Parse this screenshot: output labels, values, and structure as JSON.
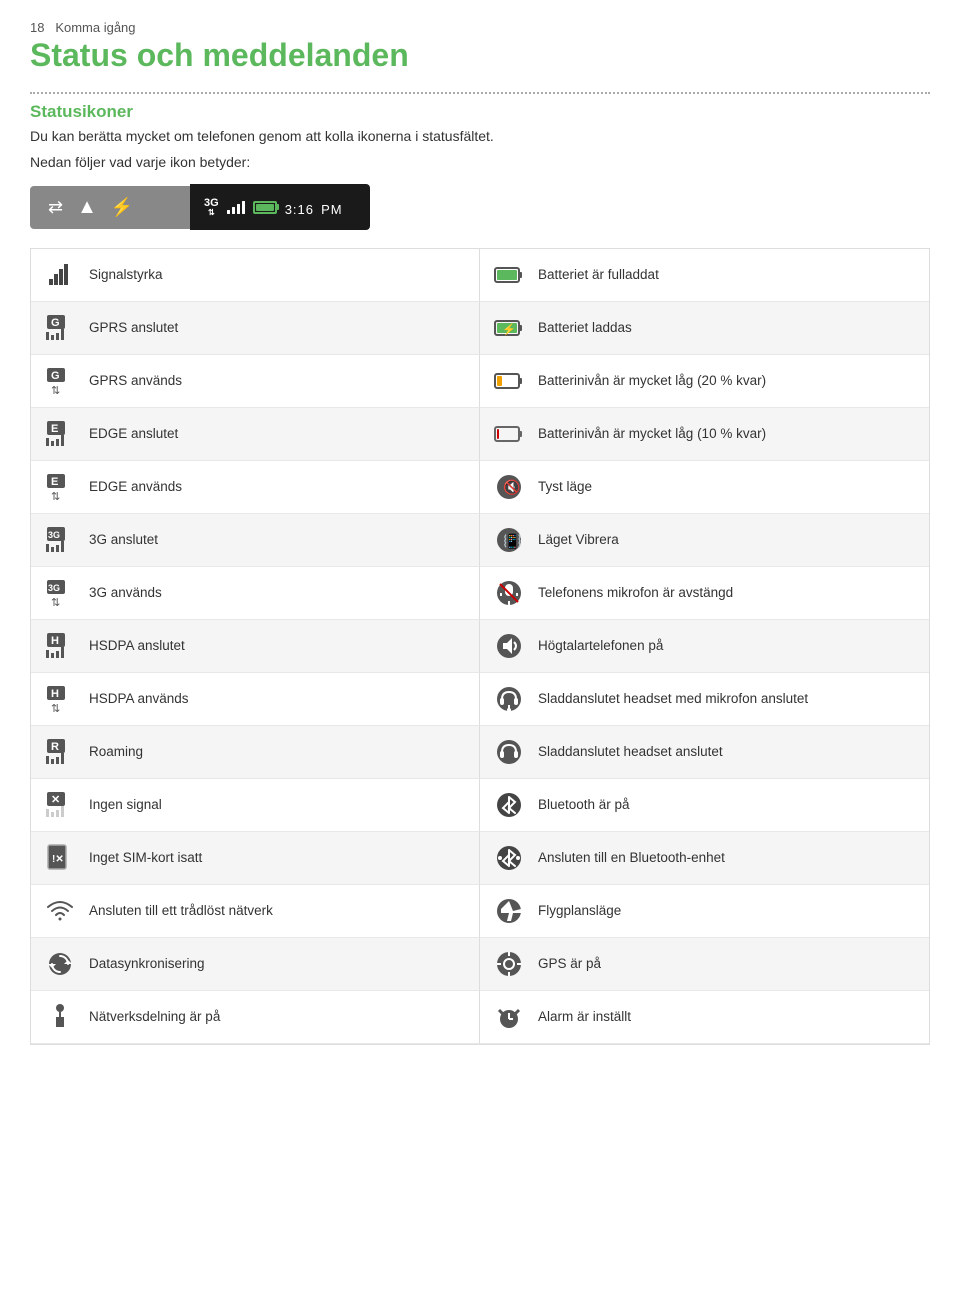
{
  "page": {
    "number": "18",
    "chapter": "Komma igång",
    "main_title": "Status och meddelanden",
    "dotted": true,
    "section_title": "Statusikoner",
    "intro": "Du kan berätta mycket om telefonen genom att kolla ikonerna i statusfältet.",
    "sub": "Nedan följer vad varje ikon betyder:"
  },
  "statusbar": {
    "time": "3:16",
    "ampm": "PM"
  },
  "icons": [
    {
      "id": "signalstyrka",
      "label": "Signalstyrka",
      "type": "signal-bars-dark",
      "side": "left"
    },
    {
      "id": "batteri-full",
      "label": "Batteriet är fulladdat",
      "type": "battery-full-green",
      "side": "right"
    },
    {
      "id": "gprs-anslutet",
      "label": "GPRS anslutet",
      "type": "badge-g-bars",
      "side": "left"
    },
    {
      "id": "batteri-laddas",
      "label": "Batteriet laddas",
      "type": "battery-charging",
      "side": "right"
    },
    {
      "id": "gprs-anvands",
      "label": "GPRS används",
      "type": "badge-g-arrows",
      "side": "left"
    },
    {
      "id": "batteri-20",
      "label": "Batterinivån är mycket låg (20 % kvar)",
      "type": "battery-20",
      "side": "right"
    },
    {
      "id": "edge-anslutet",
      "label": "EDGE anslutet",
      "type": "badge-e-bars",
      "side": "left"
    },
    {
      "id": "batteri-10",
      "label": "Batterinivån är mycket låg (10 % kvar)",
      "type": "battery-10",
      "side": "right"
    },
    {
      "id": "edge-anvands",
      "label": "EDGE används",
      "type": "badge-e-arrows",
      "side": "left"
    },
    {
      "id": "tyst-lage",
      "label": "Tyst läge",
      "type": "silent-mode",
      "side": "right"
    },
    {
      "id": "3g-anslutet",
      "label": "3G anslutet",
      "type": "badge-3g-bars",
      "side": "left"
    },
    {
      "id": "vibrera",
      "label": "Läget Vibrera",
      "type": "vibrate-mode",
      "side": "right"
    },
    {
      "id": "3g-anvands",
      "label": "3G används",
      "type": "badge-3g-arrows",
      "side": "left"
    },
    {
      "id": "mikrofon-av",
      "label": "Telefonens mikrofon är avstängd",
      "type": "mic-off",
      "side": "right"
    },
    {
      "id": "hsdpa-anslutet",
      "label": "HSDPA anslutet",
      "type": "badge-h-bars",
      "side": "left"
    },
    {
      "id": "hogtalar",
      "label": "Högtalartelefonen på",
      "type": "speakerphone",
      "side": "right"
    },
    {
      "id": "hsdpa-anvands",
      "label": "HSDPA används",
      "type": "badge-h-arrows",
      "side": "left"
    },
    {
      "id": "headset-mikrofon",
      "label": "Sladdanslutet headset med mikrofon anslutet",
      "type": "headset-mic",
      "side": "right"
    },
    {
      "id": "roaming",
      "label": "Roaming",
      "type": "roaming",
      "side": "left"
    },
    {
      "id": "headset",
      "label": "Sladdanslutet headset anslutet",
      "type": "headset",
      "side": "right"
    },
    {
      "id": "ingen-signal",
      "label": "Ingen signal",
      "type": "no-signal",
      "side": "left"
    },
    {
      "id": "bluetooth-pa",
      "label": "Bluetooth är på",
      "type": "bluetooth",
      "side": "right"
    },
    {
      "id": "inget-sim",
      "label": "Inget SIM-kort isatt",
      "type": "no-sim",
      "side": "left"
    },
    {
      "id": "bluetooth-enhet",
      "label": "Ansluten till en Bluetooth-enhet",
      "type": "bluetooth-connected",
      "side": "right"
    },
    {
      "id": "wifi",
      "label": "Ansluten till ett trådlöst nätverk",
      "type": "wifi",
      "side": "left"
    },
    {
      "id": "flygplan",
      "label": "Flygplansläge",
      "type": "airplane",
      "side": "right"
    },
    {
      "id": "synk",
      "label": "Datasynkronisering",
      "type": "sync",
      "side": "left"
    },
    {
      "id": "gps",
      "label": "GPS är på",
      "type": "gps",
      "side": "right"
    },
    {
      "id": "natverk",
      "label": "Nätverksdelning är på",
      "type": "tethering",
      "side": "left"
    },
    {
      "id": "alarm",
      "label": "Alarm är inställt",
      "type": "alarm",
      "side": "right"
    }
  ]
}
